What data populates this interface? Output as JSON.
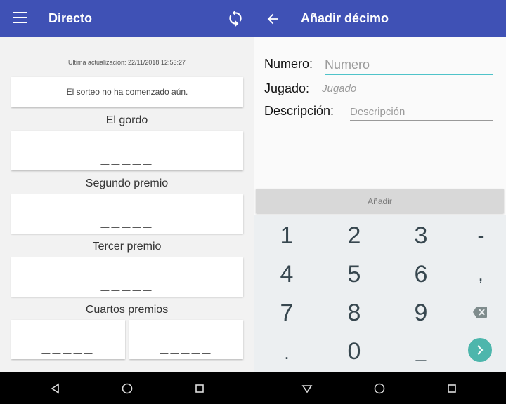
{
  "left": {
    "title": "Directo",
    "last_update": "Ultima actualización: 22/11/2018 12:53:27",
    "status": "El sorteo no ha comenzado aún.",
    "sections": {
      "gordo": {
        "label": "El gordo",
        "value": "_____"
      },
      "segundo": {
        "label": "Segundo premio",
        "value": "_____"
      },
      "tercer": {
        "label": "Tercer premio",
        "value": "_____"
      },
      "cuartos": {
        "label": "Cuartos premios",
        "values": [
          "_____",
          "_____"
        ]
      }
    },
    "icons": {
      "menu": "menu-icon",
      "refresh": "refresh-icon"
    }
  },
  "right": {
    "title": "Añadir décimo",
    "form": {
      "numero": {
        "label": "Numero:",
        "placeholder": "Numero",
        "value": ""
      },
      "jugado": {
        "label": "Jugado:",
        "placeholder": "Jugado",
        "value": ""
      },
      "descripcion": {
        "label": "Descripción:",
        "placeholder": "Descripción",
        "value": ""
      }
    },
    "add_button": "Añadir",
    "keypad": {
      "rows": [
        [
          "1",
          "2",
          "3",
          "-"
        ],
        [
          "4",
          "5",
          "6",
          ","
        ],
        [
          "7",
          "8",
          "9",
          "backspace"
        ],
        [
          ".",
          "0",
          "_",
          "next"
        ]
      ]
    },
    "icons": {
      "back": "back-arrow-icon",
      "backspace": "backspace-icon",
      "next": "next-arrow-icon"
    }
  },
  "navbar": {
    "buttons": [
      "back",
      "home",
      "recents",
      "back",
      "home",
      "recents"
    ]
  },
  "colors": {
    "appbar": "#3f51b5",
    "accent": "#4fc3c9",
    "fab": "#4db6ac"
  }
}
